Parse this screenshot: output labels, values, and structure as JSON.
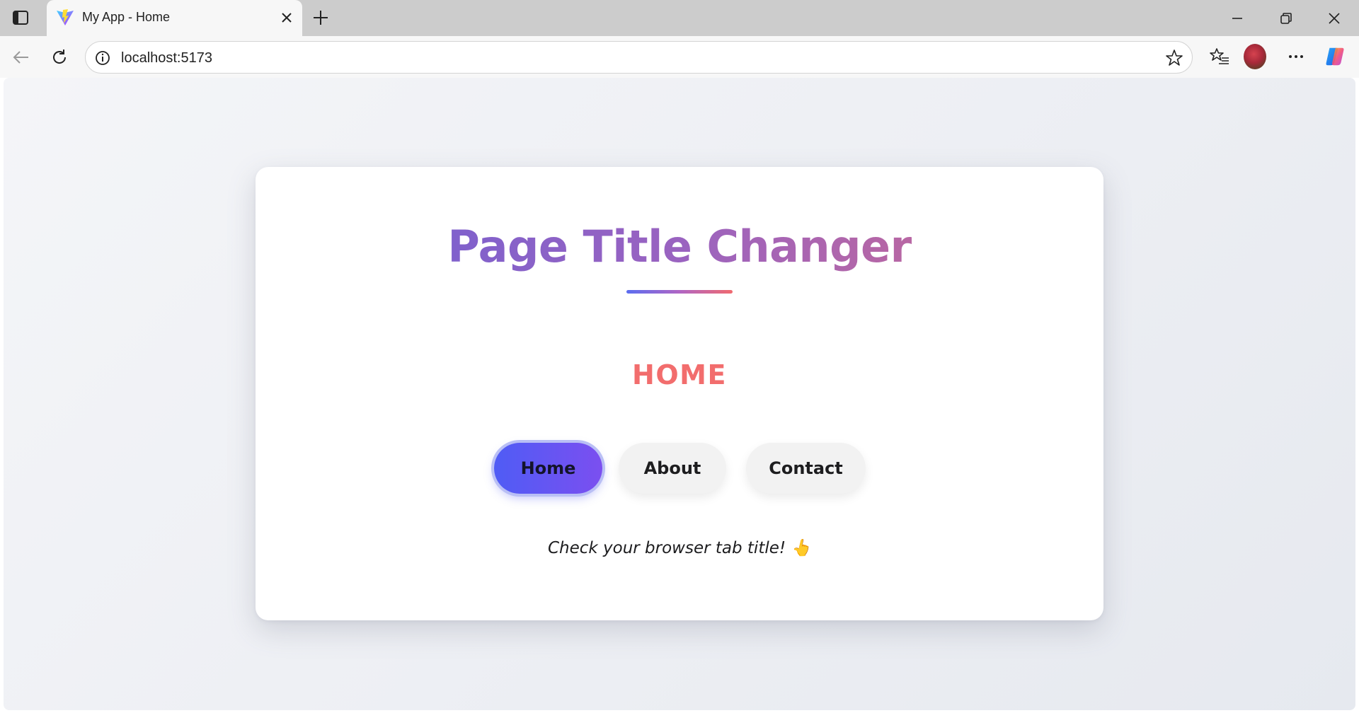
{
  "browser": {
    "tab": {
      "title": "My App - Home",
      "favicon": "vite-logo-icon"
    },
    "new_tab_icon": "plus-icon",
    "window_controls": [
      "minimize-icon",
      "restore-icon",
      "close-icon"
    ],
    "address_bar": {
      "url": "localhost:5173"
    }
  },
  "app": {
    "title": "Page Title Changer",
    "current_page_heading": "HOME",
    "nav_buttons": [
      {
        "label": "Home",
        "active": true
      },
      {
        "label": "About",
        "active": false
      },
      {
        "label": "Contact",
        "active": false
      }
    ],
    "hint": "Check your browser tab title! 👆",
    "colors": {
      "title_gradient_start": "#6a5fd6",
      "title_gradient_end": "#d16a8c",
      "heading": "#f26d6d",
      "active_button_start": "#4f5cf5",
      "active_button_end": "#7b4ff0",
      "inactive_button": "#f2f2f2"
    }
  }
}
